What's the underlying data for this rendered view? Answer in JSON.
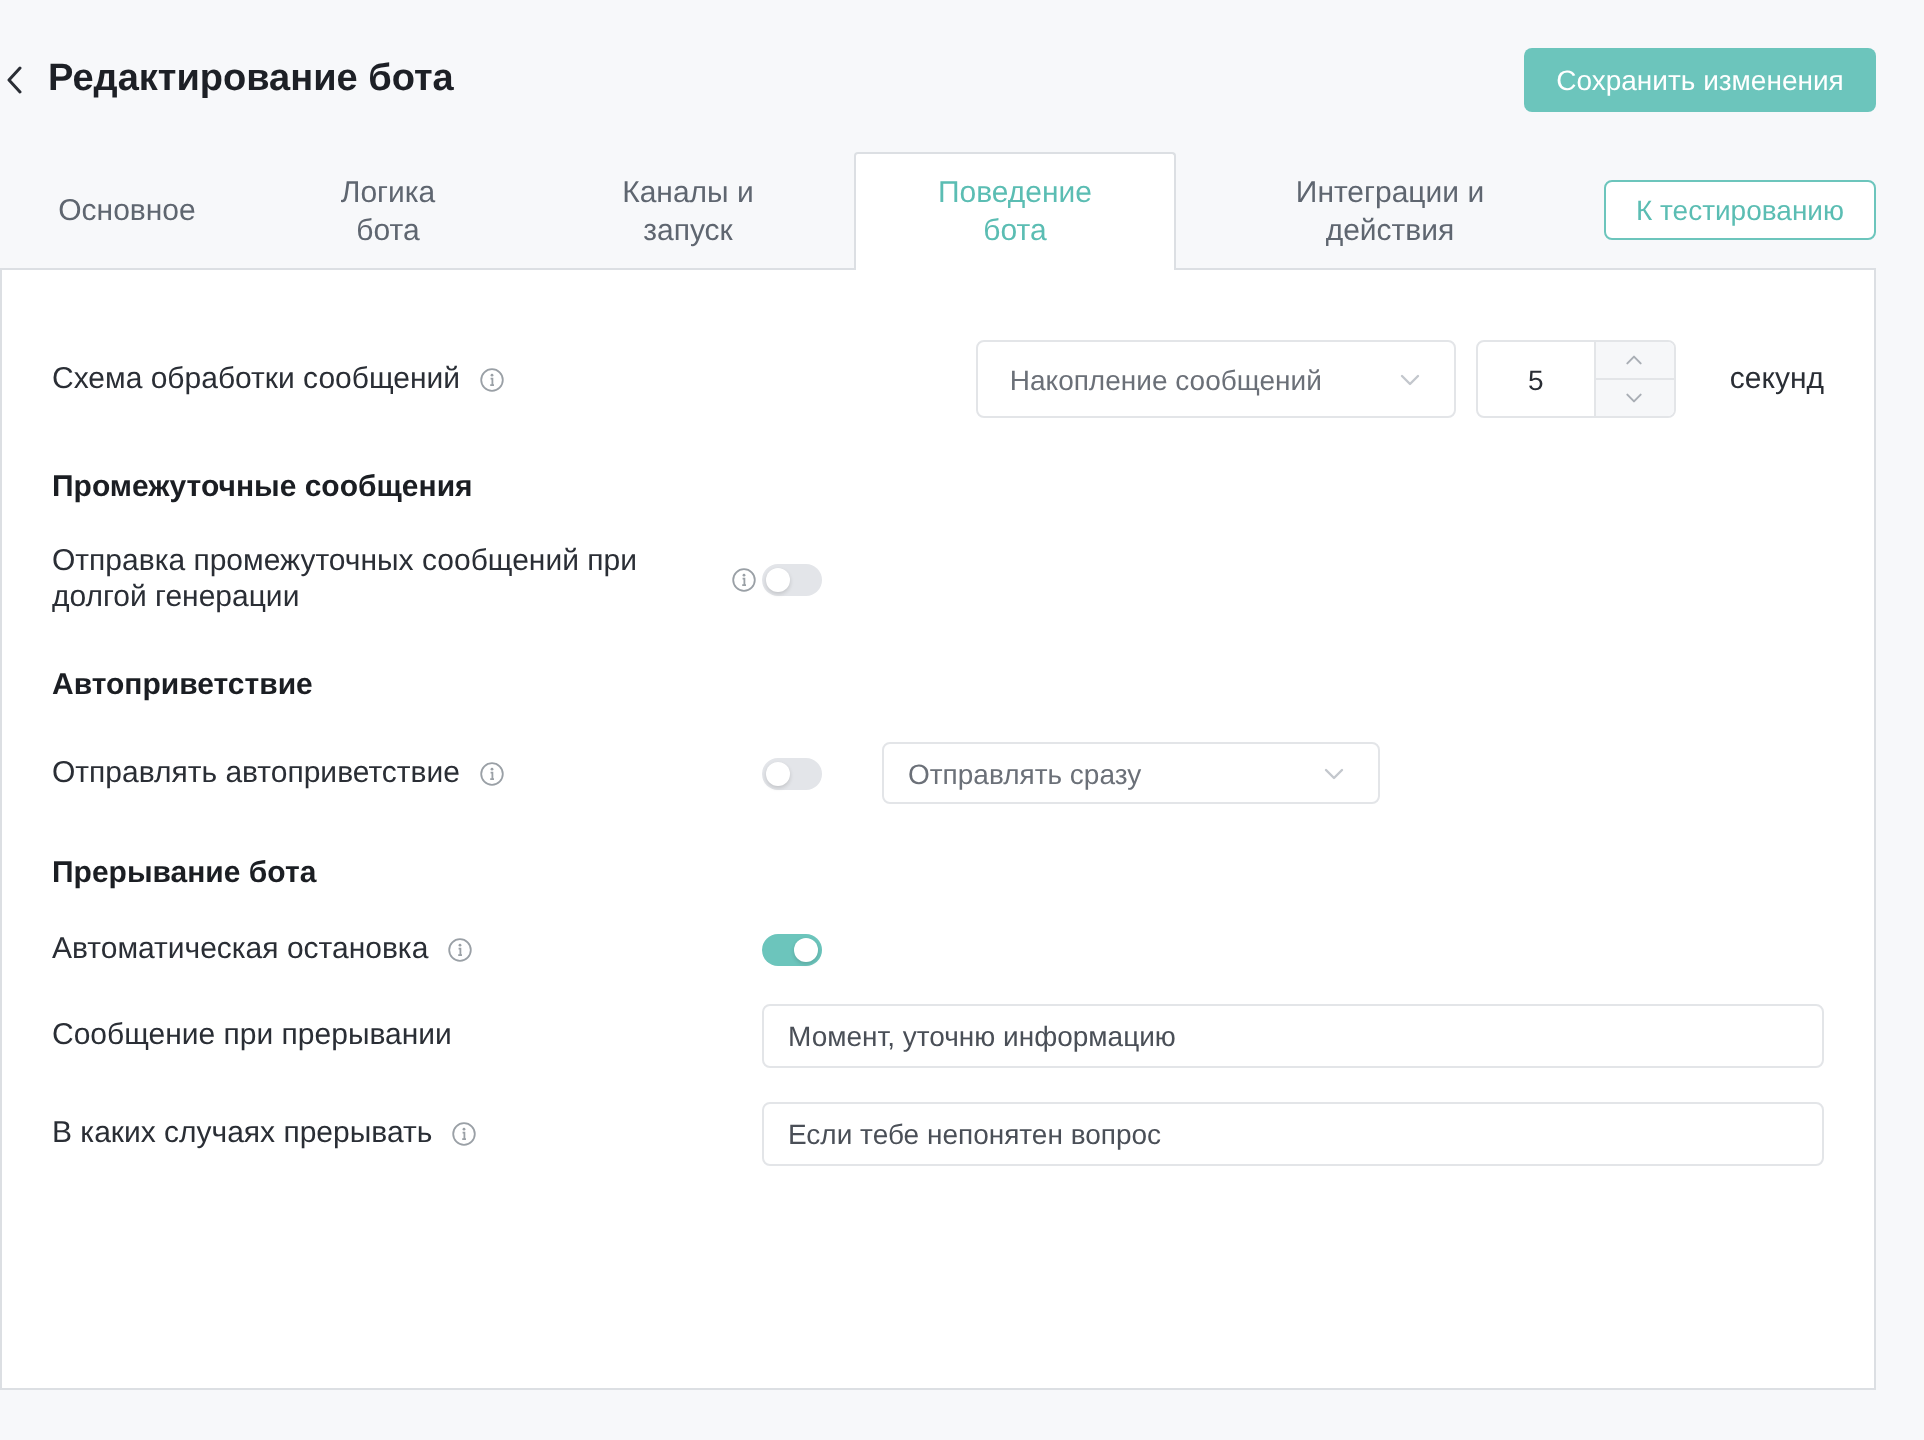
{
  "header": {
    "title": "Редактирование бота",
    "save_button": "Сохранить изменения"
  },
  "tabs": [
    {
      "label": "Основное",
      "selected": false
    },
    {
      "label": "Логика бота",
      "selected": false
    },
    {
      "label": "Каналы и запуск",
      "selected": false
    },
    {
      "label": "Поведение бота",
      "selected": true
    },
    {
      "label": "Интеграции и действия",
      "selected": false
    }
  ],
  "test_button": "К тестированию",
  "sections": [
    {
      "rows": [
        {
          "kind": "mode",
          "label": "Схема обработки сообщений",
          "info": true,
          "dropdown": "Накопление сообщений",
          "number": "5",
          "unit": "секунд"
        }
      ]
    },
    {
      "title": "Промежуточные сообщения",
      "rows": [
        {
          "kind": "toggle",
          "label": "Отправка промежуточных сообщений при долгой генерации",
          "info": true,
          "on": false
        }
      ]
    },
    {
      "title": "Автоприветствие",
      "rows": [
        {
          "kind": "toggle",
          "label": "Отправлять автоприветствие",
          "info": true,
          "on": false,
          "dropdown": "Отправлять сразу"
        }
      ]
    },
    {
      "title": "Прерывание бота",
      "rows": [
        {
          "kind": "toggle",
          "label": "Автоматическая остановка",
          "info": true,
          "on": true
        },
        {
          "kind": "text",
          "label": "Сообщение при прерывании",
          "info": false,
          "value": "Момент, уточню информацию"
        },
        {
          "kind": "text",
          "label": "В каких случаях прерывать",
          "info": true,
          "value": "Если тебе непонятен вопрос"
        }
      ]
    }
  ]
}
